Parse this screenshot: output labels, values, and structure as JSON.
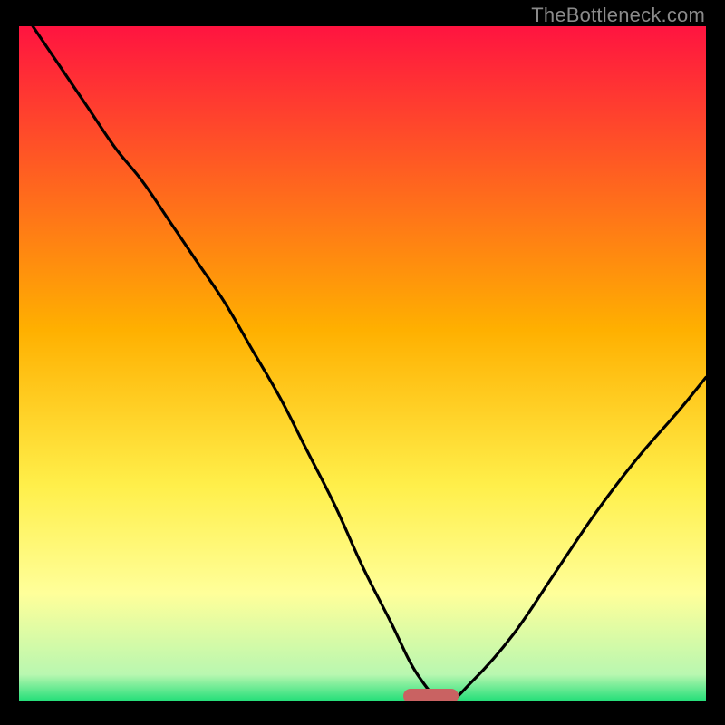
{
  "watermark": "TheBottleneck.com",
  "colors": {
    "frame": "#000000",
    "top": "#ff1440",
    "mid": "#ffd200",
    "low_yellow": "#ffff88",
    "green": "#27e07a",
    "marker": "#c96262",
    "curve": "#000000",
    "watermark_text": "#8a8a8a"
  },
  "chart_data": {
    "type": "line",
    "title": "",
    "xlabel": "",
    "ylabel": "",
    "xlim": [
      0,
      100
    ],
    "ylim": [
      0,
      100
    ],
    "gradient_stops": [
      {
        "pos": 0,
        "color": "#ff1440"
      },
      {
        "pos": 45,
        "color": "#ffb000"
      },
      {
        "pos": 68,
        "color": "#ffef4a"
      },
      {
        "pos": 84,
        "color": "#ffff9a"
      },
      {
        "pos": 96,
        "color": "#b9f7b0"
      },
      {
        "pos": 100,
        "color": "#21de78"
      }
    ],
    "series": [
      {
        "name": "bottleneck-curve",
        "x": [
          2,
          6,
          10,
          14,
          18,
          22,
          26,
          30,
          34,
          38,
          42,
          46,
          50,
          54,
          58,
          62,
          66,
          72,
          78,
          84,
          90,
          96,
          100
        ],
        "y": [
          100,
          94,
          88,
          82,
          77,
          71,
          65,
          59,
          52,
          45,
          37,
          29,
          20,
          12,
          4,
          0,
          3,
          10,
          19,
          28,
          36,
          43,
          48
        ]
      }
    ],
    "optimal_marker": {
      "x_start": 56,
      "x_end": 64,
      "y": 0
    }
  }
}
